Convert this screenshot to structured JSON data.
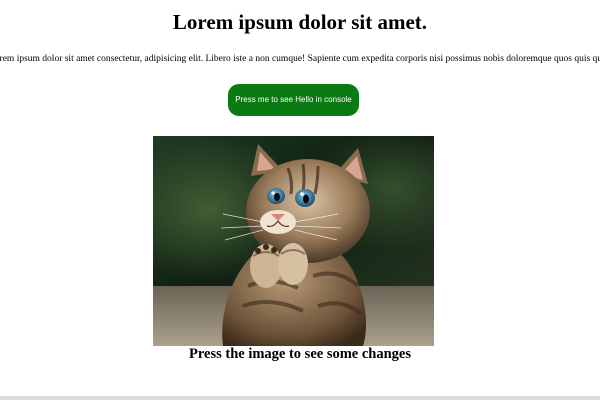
{
  "header": {
    "title": "Lorem ipsum dolor sit amet."
  },
  "body": {
    "paragraph": "Lorem ipsum dolor sit amet consectetur, adipisicing elit. Libero iste a non cumque! Sapiente cum expedita corporis nisi possimus nobis doloremque quos quis quo obcaecati"
  },
  "actions": {
    "hello_button_label": "Press me to see Hello in console",
    "button_color": "#0a7a12"
  },
  "image": {
    "subject": "kitten-praying-photo"
  },
  "caption": {
    "text": "Press the image to see some changes"
  }
}
